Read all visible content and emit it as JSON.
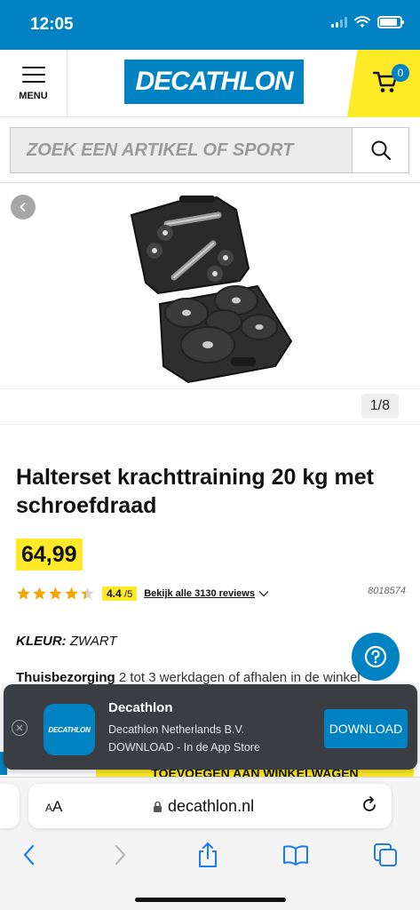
{
  "status_bar": {
    "time": "12:05",
    "battery_level": 0.85
  },
  "header": {
    "menu_label": "MENU",
    "logo_text": "DECATHLON",
    "cart_count": "0"
  },
  "search": {
    "placeholder": "ZOEK EEN ARTIKEL OF SPORT"
  },
  "gallery": {
    "counter": "1/8"
  },
  "product": {
    "title": "Halterset krachttraining 20 kg met schroefdraad",
    "price": "64,99",
    "rating": "4.4",
    "rating_scale": "/5",
    "rating_stars": 4.4,
    "reviews_link": "Bekijk alle 3130 reviews",
    "sku": "8018574",
    "color_label": "KLEUR:",
    "color_value": "ZWART",
    "delivery_label": "Thuisbezorging",
    "delivery_text": "2 tot 3 werkdagen of afhalen in de winkel",
    "add_to_cart_partial": "TOEVOEGEN AAN WINKELWAGEN"
  },
  "app_banner": {
    "icon_text": "DECATHLON",
    "app_name": "Decathlon",
    "publisher": "Decathlon Netherlands B.V.",
    "subtitle": "DOWNLOAD - In de App Store",
    "download_label": "DOWNLOAD"
  },
  "safari": {
    "aa_label_big": "A",
    "aa_label_small": "A",
    "url": "decathlon.nl"
  },
  "colors": {
    "brand_blue": "#0082c3",
    "brand_yellow": "#ffea28",
    "star_color": "#f6a400"
  }
}
